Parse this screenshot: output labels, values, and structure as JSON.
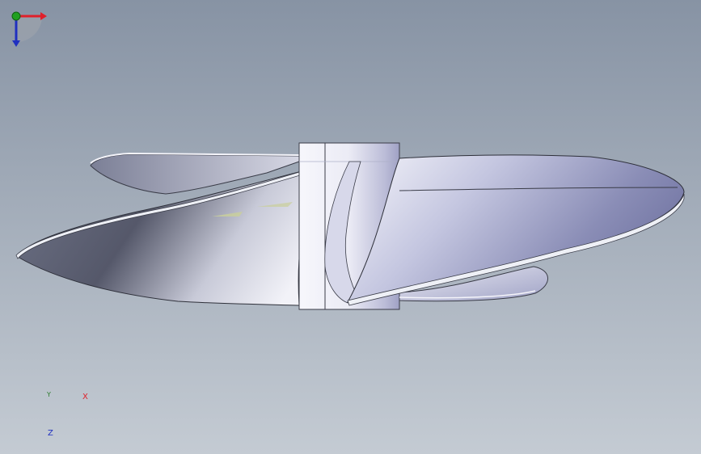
{
  "view": {
    "background_top": "#8793a4",
    "background_bottom": "#c4cbd3",
    "model": "propeller"
  },
  "triad": {
    "x_label": "X",
    "y_label": "Y",
    "z_label": "Z",
    "x_color": "#e0202a",
    "y_color": "#20a020",
    "z_color": "#2030c0"
  }
}
